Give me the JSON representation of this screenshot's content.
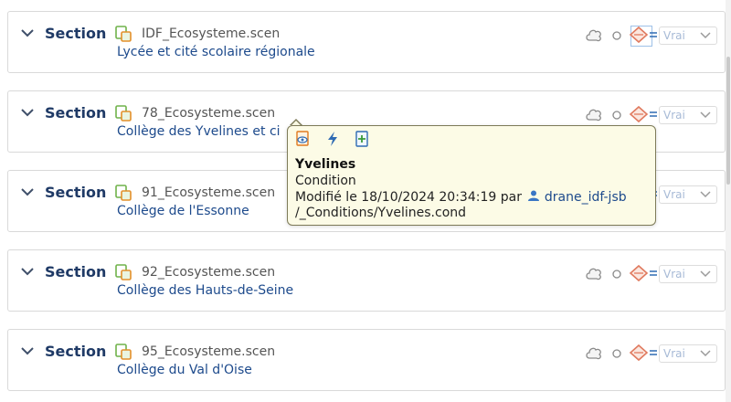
{
  "sections": [
    {
      "label": "Section",
      "file": "IDF_Ecosysteme.scen",
      "description": "Lycée et cité scolaire régionale",
      "select_value": "Vrai"
    },
    {
      "label": "Section",
      "file": "78_Ecosysteme.scen",
      "description": "Collège des Yvelines et ci",
      "select_value": "Vrai"
    },
    {
      "label": "Section",
      "file": "91_Ecosysteme.scen",
      "description": "Collège de l'Essonne",
      "select_value": "Vrai"
    },
    {
      "label": "Section",
      "file": "92_Ecosysteme.scen",
      "description": "Collège des Hauts-de-Seine",
      "select_value": "Vrai"
    },
    {
      "label": "Section",
      "file": "95_Ecosysteme.scen",
      "description": "Collège du Val d'Oise",
      "select_value": "Vrai"
    }
  ],
  "tooltip": {
    "icons": [
      "preview-icon",
      "lightning-icon",
      "add-file-icon"
    ],
    "name": "Yvelines",
    "type": "Condition",
    "modified_prefix": "Modifié le 18/10/2024 20:34:19 par ",
    "user": "drane_idf-jsb",
    "path": "/_Conditions/Yvelines.cond"
  },
  "colors": {
    "section_label": "#1f3a66",
    "link": "#1d4a8c",
    "file_icon": "#6fb24a",
    "cond_icon": "#e07a5f",
    "tooltip_bg": "#fcfbe6"
  }
}
